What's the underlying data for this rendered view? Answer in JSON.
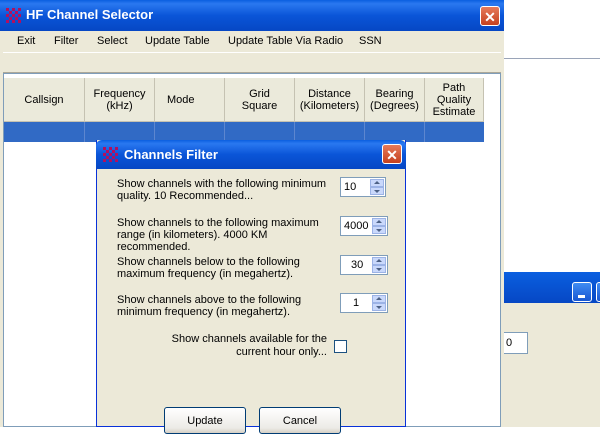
{
  "main_window": {
    "title": "HF Channel Selector",
    "close_glyph": "✕",
    "menu": [
      "Exit",
      "Filter",
      "Select",
      "Update Table",
      "Update Table Via Radio",
      "SSN"
    ],
    "columns": [
      "Callsign",
      "Frequency\n(kHz)",
      "Mode",
      "Grid\nSquare",
      "Distance\n(Kilometers)",
      "Bearing\n(Degrees)",
      "Path\nQuality\nEstimate"
    ]
  },
  "background_window": {
    "input_value": "0"
  },
  "dialog": {
    "title": "Channels Filter",
    "close_glyph": "✕",
    "settings": [
      {
        "label": "Show channels with the following minimum quality. 10 Recommended...",
        "value": "10"
      },
      {
        "label": "Show channels to the following maximum range (in kilometers). 4000 KM recommended.",
        "value": "4000"
      },
      {
        "label": "Show channels below to the following maximum frequency  (in megahertz).",
        "value": "30"
      },
      {
        "label": "Show channels above to the following minimum frequency  (in megahertz).",
        "value": "1"
      }
    ],
    "current_hour": {
      "label": "Show channels available for the current hour only...",
      "checked": false
    },
    "buttons": {
      "update": "Update",
      "cancel": "Cancel"
    }
  },
  "colors": {
    "titlebar": "#0a55d8",
    "window_bg": "#ece9d8",
    "selection": "#316ac5",
    "close_button": "#d2552f"
  },
  "icons": [
    "app-icon",
    "close-icon",
    "minimize-icon",
    "maximize-icon",
    "spin-up-icon",
    "spin-down-icon"
  ]
}
